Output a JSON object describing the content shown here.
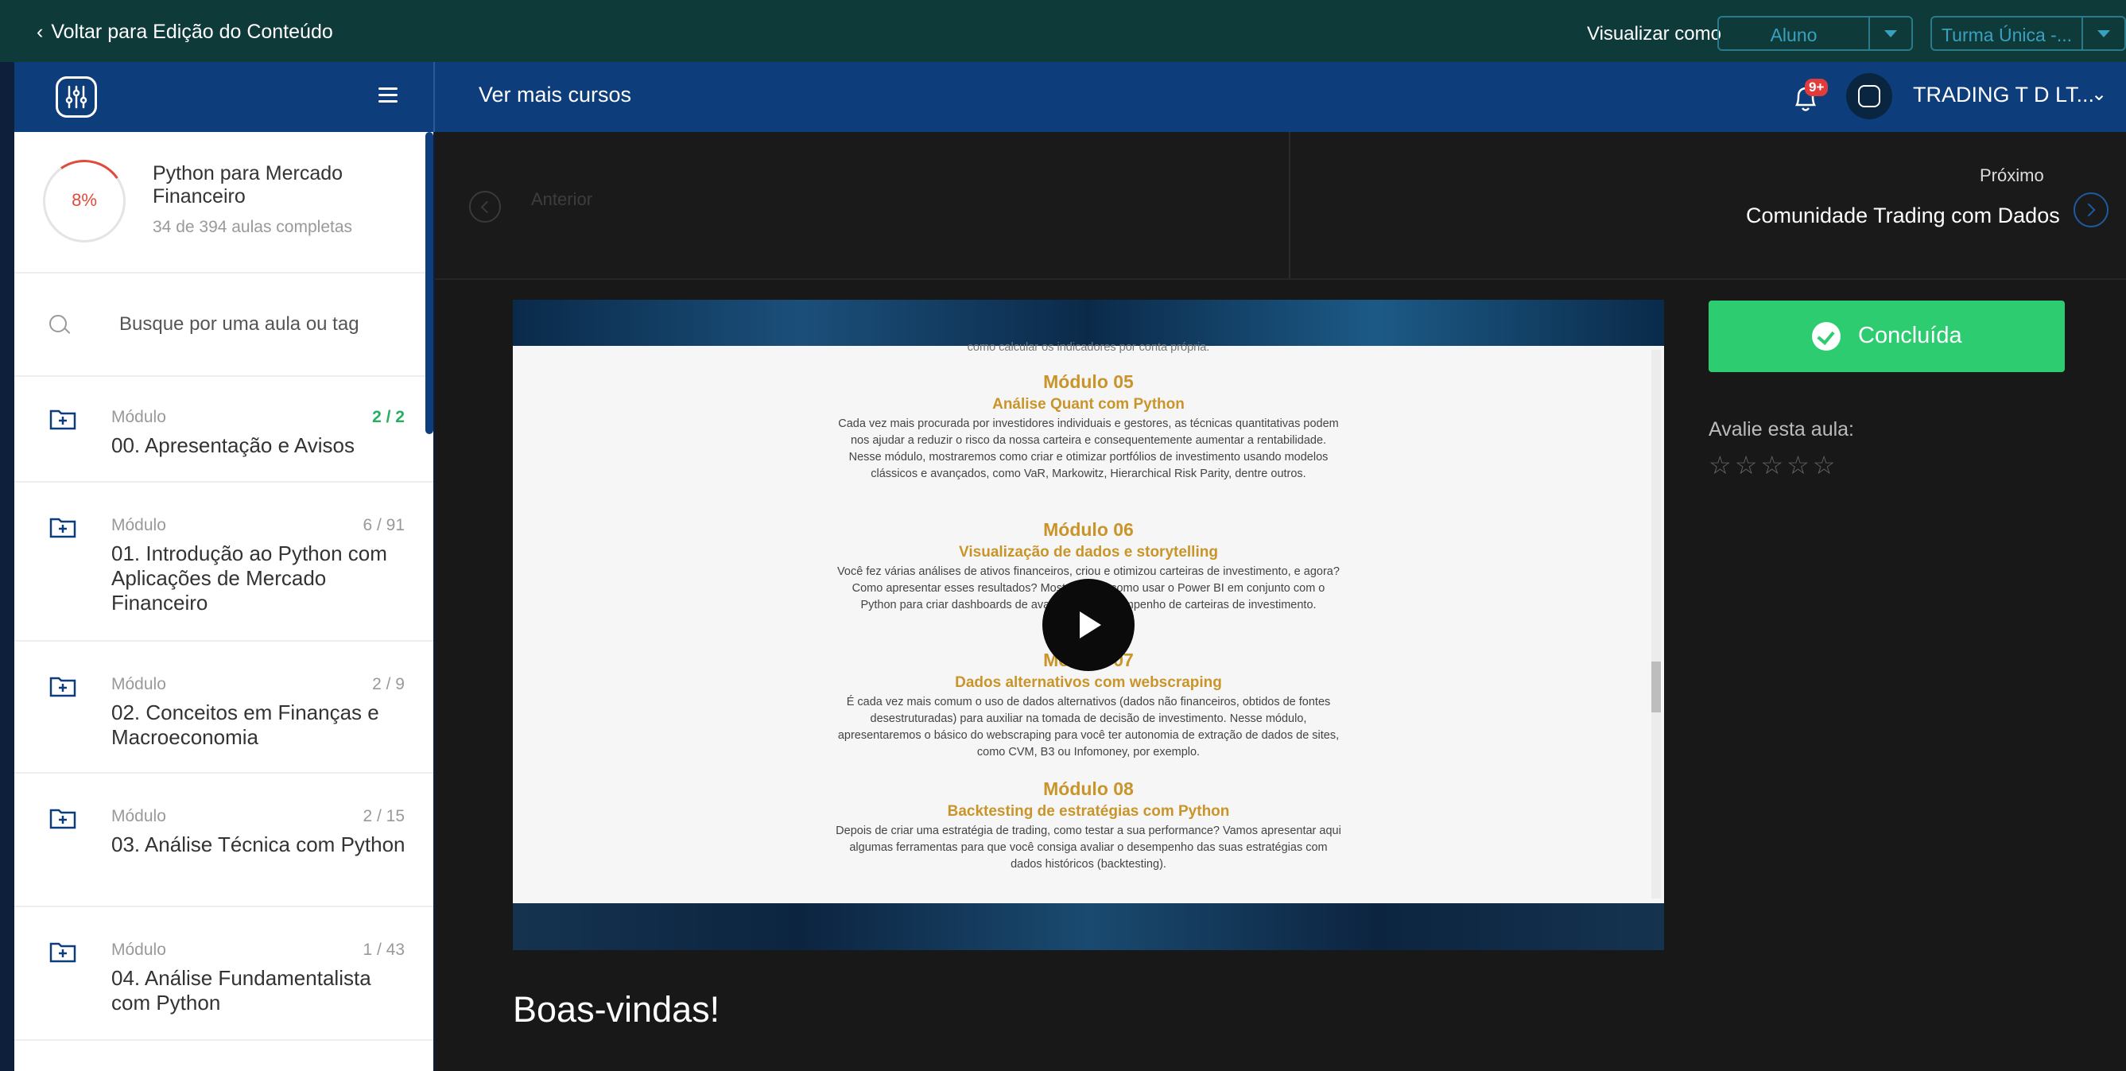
{
  "topbar": {
    "back_label": "Voltar para Edição do Conteúdo",
    "view_as_label": "Visualizar como",
    "view_as_value": "Aluno",
    "class_value": "Turma Única -..."
  },
  "header": {
    "more_courses": "Ver mais cursos",
    "notification_badge": "9+",
    "company": "TRADING T D LT..."
  },
  "course": {
    "progress_pct": "8%",
    "title": "Python para Mercado Financeiro",
    "progress_text": "34 de 394 aulas completas"
  },
  "search": {
    "placeholder": "Busque por uma aula ou tag"
  },
  "modules": [
    {
      "label": "Módulo",
      "count": "2 / 2",
      "title": "00. Apresentação e Avisos"
    },
    {
      "label": "Módulo",
      "count": "6 / 91",
      "title": "01. Introdução ao Python com Aplicações de Mercado Financeiro"
    },
    {
      "label": "Módulo",
      "count": "2 / 9",
      "title": "02. Conceitos em Finanças e Macroeconomia"
    },
    {
      "label": "Módulo",
      "count": "2 / 15",
      "title": "03. Análise Técnica com Python"
    },
    {
      "label": "Módulo",
      "count": "1 / 43",
      "title": "04. Análise Fundamentalista com Python"
    }
  ],
  "nav": {
    "prev_label": "Anterior",
    "next_label": "Próximo",
    "next_title": "Comunidade Trading com Dados"
  },
  "slide": {
    "top_line": "como calcular os indicadores por conta própria.",
    "m5_title": "Módulo 05",
    "m5_sub": "Análise Quant com Python",
    "m5_text": "Cada vez mais procurada por investidores individuais e gestores, as técnicas quantitativas podem nos ajudar a reduzir o risco da nossa carteira e consequentemente aumentar a rentabilidade. Nesse módulo, mostraremos como criar e otimizar portfólios de investimento usando modelos clássicos e avançados, como VaR, Markowitz, Hierarchical Risk Parity, dentre outros.",
    "m6_title": "Módulo 06",
    "m6_sub": "Visualização de dados e storytelling",
    "m6_text": "Você fez várias análises de ativos financeiros, criou e otimizou carteiras de investimento, e agora? Como apresentar esses resultados? Mostraremos como usar o Power BI em conjunto com o Python para criar dashboards de avaliação de desempenho de carteiras de investimento.",
    "m7_title": "Módulo 07",
    "m7_sub": "Dados alternativos com webscraping",
    "m7_text": "É cada vez mais comum o uso de dados alternativos (dados não financeiros, obtidos de fontes desestruturadas) para auxiliar na tomada de decisão de investimento. Nesse módulo, apresentaremos o básico do webscraping para você ter autonomia de extração de dados de sites, como CVM, B3 ou Infomoney, por exemplo.",
    "m8_title": "Módulo 08",
    "m8_sub": "Backtesting de estratégias com Python",
    "m8_text": "Depois de criar uma estratégia de trading, como testar a sua performance? Vamos apresentar aqui algumas ferramentas para que você consiga avaliar o desempenho das suas estratégias com dados históricos (backtesting)."
  },
  "lesson": {
    "title": "Boas-vindas!"
  },
  "actions": {
    "completed_label": "Concluída",
    "rate_label": "Avalie esta aula:",
    "stars": "☆☆☆☆☆"
  }
}
